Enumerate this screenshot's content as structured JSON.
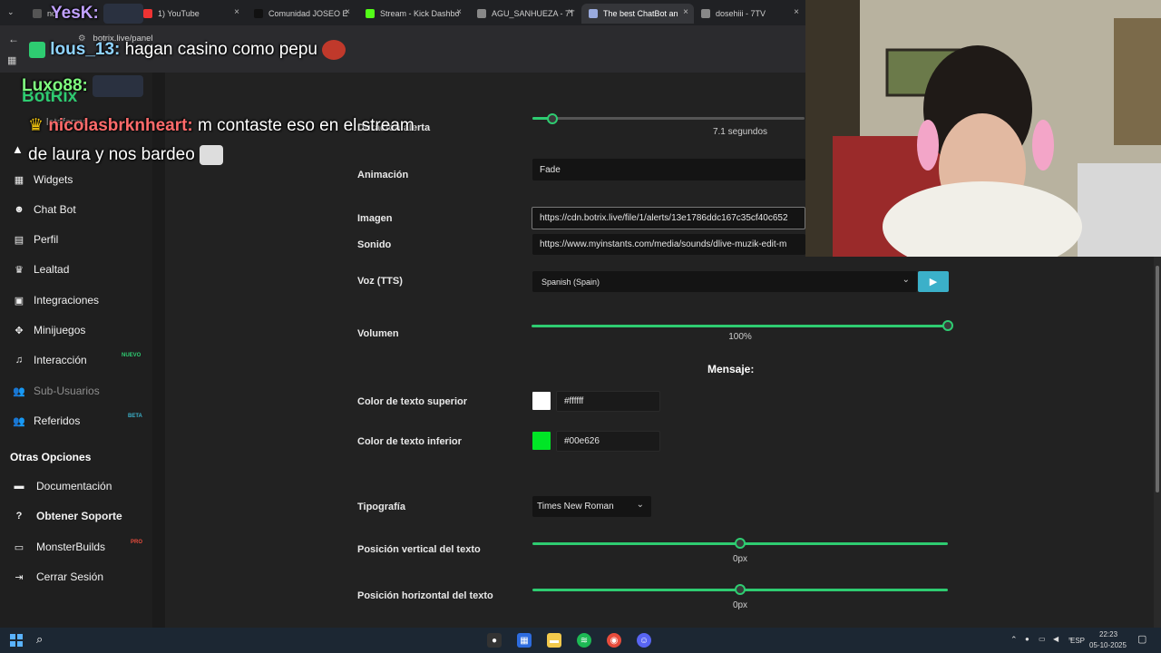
{
  "browser": {
    "tabs": [
      {
        "label": "no",
        "close": "×"
      },
      {
        "label": "1) YouTube",
        "close": "×"
      },
      {
        "label": "Comunidad JOSEO E",
        "close": "×"
      },
      {
        "label": "Stream - Kick Dashbo",
        "close": "×"
      },
      {
        "label": "AGU_SANHUEZA - 7T",
        "close": "×"
      },
      {
        "label": "The best ChatBot an",
        "close": "×"
      },
      {
        "label": "dosehiii - 7TV",
        "close": "×"
      }
    ],
    "url": "botrix.live/panel"
  },
  "chat_overlay": {
    "messages": [
      {
        "user": "YesK:",
        "text": ""
      },
      {
        "user": "lous_13:",
        "text": "hagan casino como pepu"
      },
      {
        "user": "Luxo88:",
        "text": ""
      },
      {
        "user": "nicolasbrknheart:",
        "text": "m contaste eso en el stream de laura y nos bardeo"
      }
    ],
    "logo_text": "BotRix",
    "partial_text": "lataforma"
  },
  "sidebar": {
    "items": [
      {
        "label": "Widgets",
        "icon": "table-icon"
      },
      {
        "label": "Chat Bot",
        "icon": "robot-icon"
      },
      {
        "label": "Perfil",
        "icon": "id-card-icon"
      },
      {
        "label": "Lealtad",
        "icon": "trophy-icon"
      },
      {
        "label": "Integraciones",
        "icon": "integrations-icon"
      },
      {
        "label": "Minijuegos",
        "icon": "gamepad-icon"
      },
      {
        "label": "Interacción",
        "icon": "music-icon",
        "badge": "NUEVO"
      },
      {
        "label": "Sub-Usuarios",
        "icon": "users-icon"
      },
      {
        "label": "Referidos",
        "icon": "referrals-icon",
        "badge": "BETA"
      }
    ],
    "section_title": "Otras Opciones",
    "other_items": [
      {
        "label": "Documentación",
        "icon": "book-icon"
      },
      {
        "label": "Obtener Soporte",
        "icon": "help-icon"
      },
      {
        "label": "MonsterBuilds",
        "icon": "monitor-icon",
        "badge": "PRO"
      },
      {
        "label": "Cerrar Sesión",
        "icon": "logout-icon"
      }
    ]
  },
  "form": {
    "duration": {
      "label": "Duración alerta",
      "value": "7.1 segundos"
    },
    "animation": {
      "label": "Animación",
      "value": "Fade"
    },
    "image": {
      "label": "Imagen",
      "value": "https://cdn.botrix.live/file/1/alerts/13e1786ddc167c35cf40c652"
    },
    "sound": {
      "label": "Sonido",
      "value": "https://www.myinstants.com/media/sounds/dlive-muzik-edit-m"
    },
    "tts": {
      "label": "Voz (TTS)",
      "value": "Spanish (Spain)"
    },
    "volume": {
      "label": "Volumen",
      "value": "100%",
      "level": 1.0
    },
    "message_heading": "Mensaje:",
    "top_color": {
      "label": "Color de texto superior",
      "value": "#ffffff",
      "swatch": "#ffffff"
    },
    "bottom_color": {
      "label": "Color de texto inferior",
      "value": "#00e626",
      "swatch": "#00e626"
    },
    "font": {
      "label": "Tipografía",
      "value": "Times New Roman"
    },
    "v_pos": {
      "label": "Posición vertical del texto",
      "value": "0px",
      "level": 0.5
    },
    "h_pos": {
      "label": "Posición horizontal del texto",
      "value": "0px",
      "level": 0.5
    }
  },
  "taskbar": {
    "lang": "ESP",
    "time": "22:23",
    "date": "05-10-2025"
  },
  "colors": {
    "accent": "#2ecc71",
    "play_button": "#3bb0c9"
  }
}
